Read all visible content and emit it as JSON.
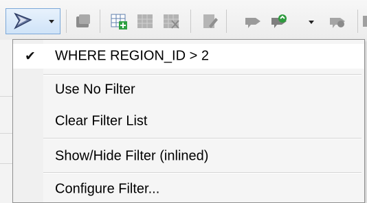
{
  "menu": {
    "items": [
      {
        "label": "WHERE REGION_ID > 2",
        "checked": true
      },
      {
        "label": "Use No Filter",
        "checked": false
      },
      {
        "label": "Clear Filter List",
        "checked": false
      },
      {
        "label": "Show/Hide Filter (inlined)",
        "checked": false
      },
      {
        "label": "Configure Filter...",
        "checked": false
      }
    ],
    "check_glyph": "✔"
  },
  "toolbar": {
    "icons": [
      "filter-icon",
      "table-icon",
      "add-row-icon",
      "delete-row-icon",
      "copy-row-icon",
      "edit-icon",
      "arrow-left-icon",
      "refresh-icon",
      "arrow-right-icon"
    ]
  }
}
